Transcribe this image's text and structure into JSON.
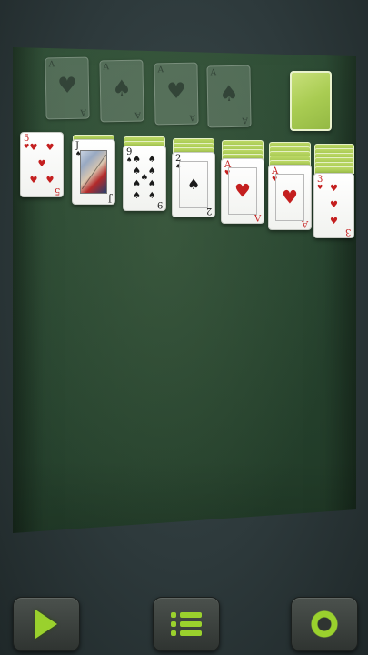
{
  "foundations": [
    {
      "suit": "♥",
      "suit_name": "hearts",
      "label": "A",
      "color": "red"
    },
    {
      "suit": "♠",
      "suit_name": "spades",
      "label": "A",
      "color": "black"
    },
    {
      "suit": "♥",
      "suit_name": "hearts",
      "label": "A",
      "color": "red"
    },
    {
      "suit": "♠",
      "suit_name": "spades",
      "label": "A",
      "color": "black"
    }
  ],
  "stock": {
    "state": "face-down",
    "back_color": "#a9cc52"
  },
  "tableau": [
    {
      "face_down": 0,
      "top": {
        "rank": "5",
        "suit": "♥",
        "color": "red"
      }
    },
    {
      "face_down": 1,
      "top": {
        "rank": "J",
        "suit": "♠",
        "color": "black"
      }
    },
    {
      "face_down": 2,
      "top": {
        "rank": "9",
        "suit": "♠",
        "color": "black"
      }
    },
    {
      "face_down": 3,
      "top": {
        "rank": "2",
        "suit": "♠",
        "color": "black"
      }
    },
    {
      "face_down": 4,
      "top": {
        "rank": "A",
        "suit": "♥",
        "color": "red"
      }
    },
    {
      "face_down": 5,
      "top": {
        "rank": "A",
        "suit": "♥",
        "color": "red"
      }
    },
    {
      "face_down": 6,
      "top": {
        "rank": "3",
        "suit": "♥",
        "color": "red"
      }
    }
  ],
  "buttons": {
    "play": {
      "icon": "play-icon"
    },
    "menu": {
      "icon": "menu-icon"
    },
    "settings": {
      "icon": "gear-icon"
    }
  },
  "colors": {
    "accent": "#9ad12d",
    "felt": "#284530",
    "card_back": "#a9cc52"
  }
}
